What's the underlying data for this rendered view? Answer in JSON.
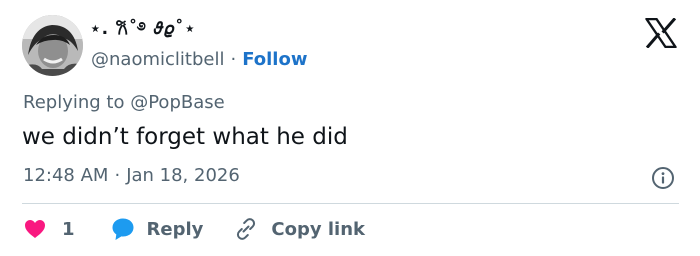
{
  "user": {
    "display_name": "⋆. 𐙚˚࿔ 𝜗𝜚˚⋆",
    "handle": "@naomiclitbell",
    "separator": "·",
    "follow_label": "Follow"
  },
  "reply": {
    "prefix": "Replying to",
    "mention": "@PopBase"
  },
  "tweet": {
    "text": "we didn’t forget what he did",
    "time": "12:48 AM",
    "separator": "·",
    "date": "Jan 18, 2026"
  },
  "actions": {
    "like_count": "1",
    "reply_label": "Reply",
    "copy_link_label": "Copy link"
  },
  "colors": {
    "accent": "#1d73c9",
    "like": "#f91880",
    "reply_bubble": "#1d9bf0",
    "secondary_text": "#536471",
    "primary_text": "#0f1419",
    "divider": "#cfd9de"
  },
  "icons": {
    "brand": "x-logo-icon",
    "like": "heart-icon",
    "reply": "speech-bubble-icon",
    "copy": "link-icon",
    "info": "info-icon"
  }
}
